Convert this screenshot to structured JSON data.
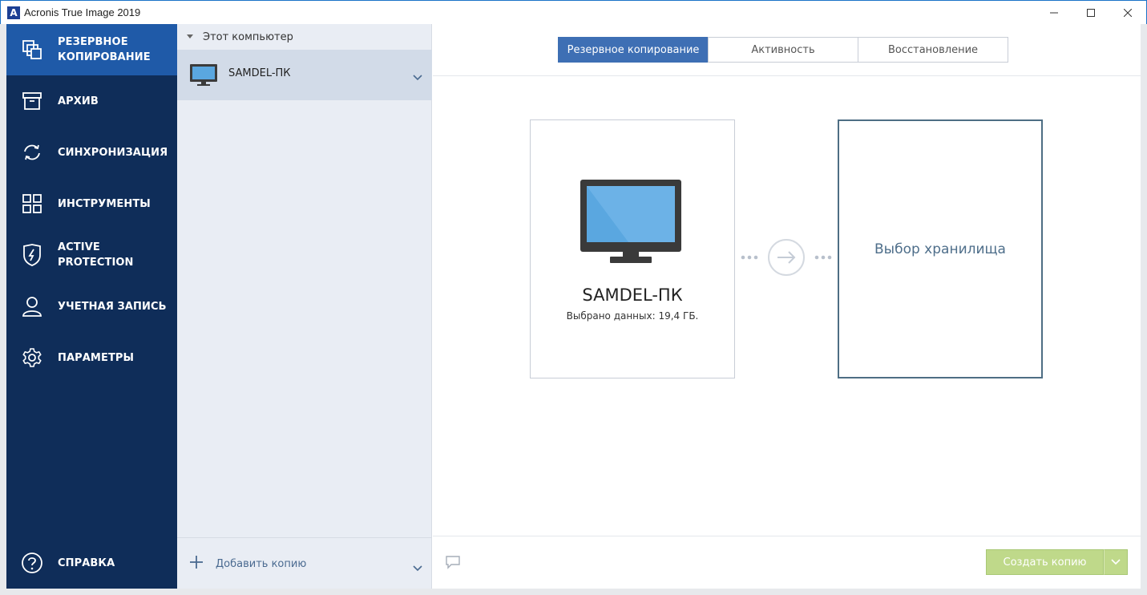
{
  "window": {
    "title": "Acronis True Image 2019",
    "logo_letter": "A"
  },
  "sidebar": {
    "items": [
      {
        "label_line1": "РЕЗЕРВНОЕ",
        "label_line2": "КОПИРОВАНИЕ",
        "icon": "backup-icon",
        "active": true
      },
      {
        "label_line1": "АРХИВ",
        "label_line2": "",
        "icon": "archive-icon",
        "active": false
      },
      {
        "label_line1": "СИНХРОНИЗАЦИЯ",
        "label_line2": "",
        "icon": "sync-icon",
        "active": false
      },
      {
        "label_line1": "ИНСТРУМЕНТЫ",
        "label_line2": "",
        "icon": "tools-grid-icon",
        "active": false
      },
      {
        "label_line1": "ACTIVE",
        "label_line2": "PROTECTION",
        "icon": "shield-icon",
        "active": false
      },
      {
        "label_line1": "УЧЕТНАЯ ЗАПИСЬ",
        "label_line2": "",
        "icon": "user-icon",
        "active": false
      },
      {
        "label_line1": "ПАРАМЕТРЫ",
        "label_line2": "",
        "icon": "gear-icon",
        "active": false
      }
    ],
    "help": {
      "label": "СПРАВКА",
      "icon": "help-icon"
    }
  },
  "list_panel": {
    "group_label": "Этот компьютер",
    "item_label": "SAMDEL-ПК",
    "add_label": "Добавить копию"
  },
  "main": {
    "tabs": [
      {
        "label": "Резервное копирование",
        "active": true
      },
      {
        "label": "Активность",
        "active": false
      },
      {
        "label": "Восстановление",
        "active": false
      }
    ],
    "source": {
      "name": "SAMDEL-ПК",
      "size_text": "Выбрано данных: 19,4 ГБ."
    },
    "destination": {
      "label": "Выбор хранилища"
    },
    "create_button": "Создать копию"
  },
  "colors": {
    "sidebar_bg": "#0f2d59",
    "sidebar_active": "#1f5aa8",
    "tab_active": "#3e6fb4",
    "create_button": "#bfd98a"
  }
}
